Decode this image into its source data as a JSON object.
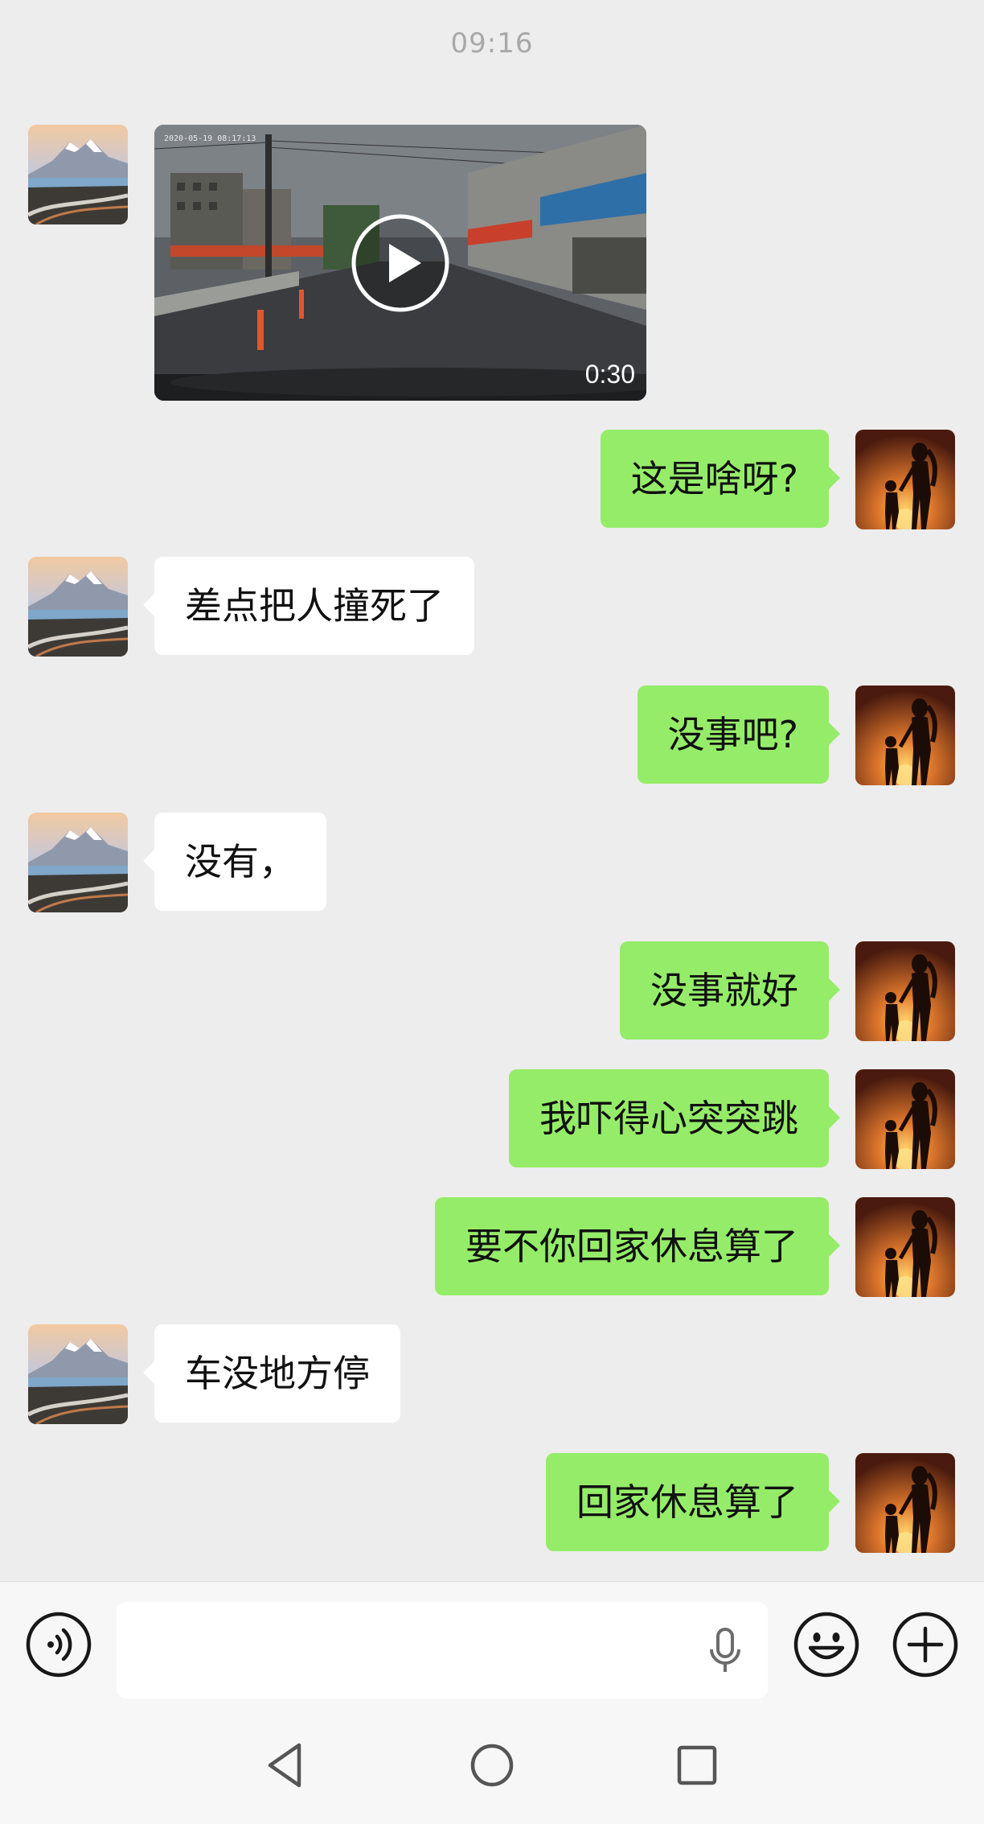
{
  "timestamp": "09:16",
  "video_message": {
    "duration": "0:30",
    "overlay_stamp": "2020-05-19 08:17:13"
  },
  "messages": [
    {
      "side": "out",
      "text": "这是啥呀?"
    },
    {
      "side": "in",
      "text": "差点把人撞死了"
    },
    {
      "side": "out",
      "text": "没事吧?"
    },
    {
      "side": "in",
      "text": "没有，"
    },
    {
      "side": "out",
      "text": "没事就好"
    },
    {
      "side": "out",
      "text": "我吓得心突突跳"
    },
    {
      "side": "out",
      "text": "要不你回家休息算了"
    },
    {
      "side": "in",
      "text": "车没地方停"
    },
    {
      "side": "out",
      "text": "回家休息算了"
    }
  ],
  "input_bar": {
    "voice_icon": "voice-toggle-icon",
    "mic_icon": "microphone-icon",
    "emoji_icon": "emoji-icon",
    "more_icon": "plus-icon",
    "value": ""
  },
  "nav_bar": {
    "back_icon": "triangle-back-icon",
    "home_icon": "circle-home-icon",
    "recents_icon": "square-recents-icon"
  },
  "colors": {
    "background": "#ededed",
    "outgoing_bubble": "#95ec69",
    "incoming_bubble": "#ffffff"
  }
}
